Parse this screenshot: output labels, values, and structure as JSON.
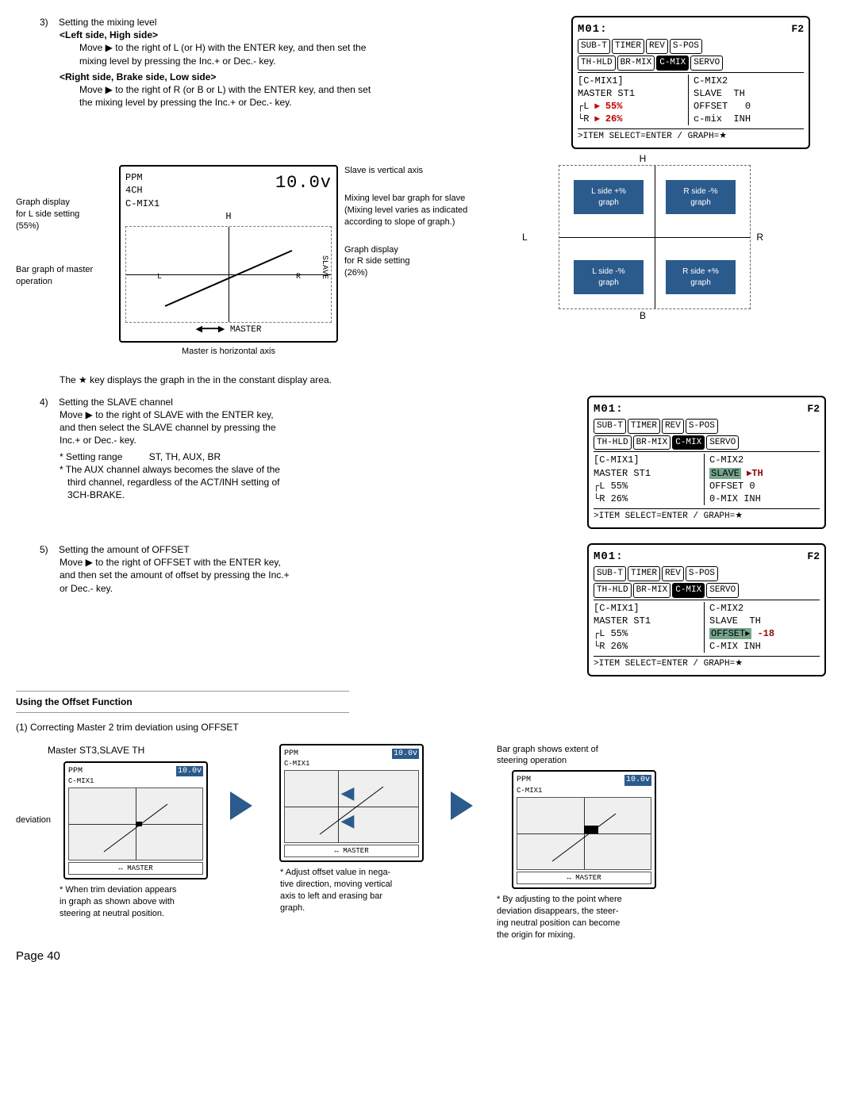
{
  "step3": {
    "num": "3)",
    "title": "Setting the mixing level",
    "left_title": "<Left side, High side>",
    "left_line1": "Move ▶ to the right of L (or H) with the ENTER key, and then set the",
    "left_line2": "mixing level by pressing the Inc.+ or Dec.- key.",
    "right_title": "<Right side, Brake side, Low side>",
    "right_line1": "Move ▶ to the right of R (or B or L) with the ENTER key, and then set",
    "right_line2": "the mixing level by pressing the Inc.+ or Dec.- key."
  },
  "lcd1": {
    "hdr": "M01:",
    "f2": "F2",
    "tab1": "SUB-T",
    "tab2": "TIMER",
    "tab3": "REV",
    "tab4": "S-POS",
    "tab5": "TH-HLD",
    "tab6": "BR-MIX",
    "tab7": "C-MIX",
    "tab8": "SERVO",
    "leftTitle": "[C-MIX1]",
    "master": "MASTER",
    "st1": "ST1",
    "v1": "▸ 55%",
    "v2": "▸ 26%",
    "rightTitle": "C-MIX2",
    "slave": "SLAVE",
    "th": "TH",
    "offset": "OFFSET",
    "zero": "0",
    "cmix": "c-mix",
    "inh": "INH",
    "foot": ">ITEM SELECT=ENTER / GRAPH=★"
  },
  "graph": {
    "ppm": "PPM",
    "uch": "4CH",
    "cmix1": "C-MIX1",
    "val": "10.0v",
    "h": "H",
    "slave_axis": "SLAVE",
    "master_axis": "MASTER",
    "ann_top": "Slave is vertical axis",
    "ann_left1": "Graph display",
    "ann_left2": "for L side setting",
    "ann_left3": "(55%)",
    "ann_left4": "Bar graph of master",
    "ann_left5": "operation",
    "ann_right1": "Mixing level bar graph for slave",
    "ann_right2": "(Mixing level varies as indicated",
    "ann_right3": "according to slope of graph.)",
    "ann_right4": "Graph display",
    "ann_right5": "for R side setting",
    "ann_right6": "(26%)",
    "ann_bottom": "Master is horizontal axis"
  },
  "quadrant": {
    "H": "H",
    "B": "B",
    "L": "L",
    "R": "R",
    "tl1": "L side +%",
    "tl2": "graph",
    "tr1": "R side -%",
    "tr2": "graph",
    "bl1": "L side -%",
    "bl2": "graph",
    "br1": "R side +%",
    "br2": "graph"
  },
  "starline": "The ★ key displays the graph in the in the constant display area.",
  "step4": {
    "num": "4)",
    "title": "Setting the SLAVE channel",
    "l1": "Move ▶ to the right of SLAVE with the ENTER key,",
    "l2": "and then select the SLAVE channel by pressing the",
    "l3": "Inc.+ or Dec.- key.",
    "b1": "* Setting range",
    "b1v": "ST, TH, AUX, BR",
    "b2a": "* The AUX channel always becomes the slave of the",
    "b2b": "third channel, regardless of the ACT/INH setting of",
    "b2c": "3CH-BRAKE."
  },
  "lcd2": {
    "hdr": "M01:",
    "f2": "F2",
    "tab1": "SUB-T",
    "tab2": "TIMER",
    "tab3": "REV",
    "tab4": "S-POS",
    "tab5": "TH-HLD",
    "tab6": "BR-MIX",
    "tab7": "C-MIX",
    "tab8": "SERVO",
    "leftTitle": "[C-MIX1]",
    "master": "MASTER",
    "st1": "ST1",
    "v1": "55%",
    "v2": "26%",
    "rightTitle": "C-MIX2",
    "slave": "SLAVE",
    "th": "▸TH",
    "offset": "OFFSET",
    "zero": "0",
    "cmix": "0-MIX",
    "inh": "INH",
    "foot": ">ITEM SELECT=ENTER / GRAPH=★"
  },
  "step5": {
    "num": "5)",
    "title": "Setting the amount of OFFSET",
    "l1": "Move ▶ to the right of OFFSET with the ENTER key,",
    "l2": "and then set the amount of offset by pressing the Inc.+",
    "l3": "or Dec.- key."
  },
  "lcd3": {
    "hdr": "M01:",
    "f2": "F2",
    "tab1": "SUB-T",
    "tab2": "TIMER",
    "tab3": "REV",
    "tab4": "S-POS",
    "tab5": "TH-HLD",
    "tab6": "BR-MIX",
    "tab7": "C-MIX",
    "tab8": "SERVO",
    "leftTitle": "[C-MIX1]",
    "master": "MASTER",
    "st1": "ST1",
    "v1": "55%",
    "v2": "26%",
    "rightTitle": "C-MIX2",
    "slave": "SLAVE",
    "th": "TH",
    "offset": "OFFSET▸",
    "offval": "-18",
    "cmix": "C-MIX",
    "inh": "INH",
    "foot": ">ITEM SELECT=ENTER / GRAPH=★"
  },
  "offset": {
    "title": "Using the Offset Function",
    "sub": "(1) Correcting Master 2 trim deviation using OFFSET",
    "master_label": "Master ST3,SLAVE TH",
    "dev_label": "deviation",
    "mini_val_a": "10.0v",
    "mini_val_b": "10.0v",
    "mini_val_c": "10.0v",
    "mini_lbl_a": "C-MIX1",
    "mini_lbl_b": "C-MIX1",
    "mini_lbl_c": "C-MIX1",
    "mini_master": "↔ MASTER",
    "cap_a1": "* When trim deviation appears",
    "cap_a2": "in graph as shown above with",
    "cap_a3": "steering at neutral position.",
    "cap_b1": "* Adjust offset value in nega-",
    "cap_b2": "tive direction, moving vertical",
    "cap_b3": "axis to left and erasing bar",
    "cap_b4": "graph.",
    "bar_caption1": "Bar graph shows extent of",
    "bar_caption2": "steering operation",
    "cap_c1": "* By adjusting to the point where",
    "cap_c2": "deviation disappears, the steer-",
    "cap_c3": "ing neutral position can become",
    "cap_c4": "the origin for mixing."
  },
  "pageno": "Page 40"
}
